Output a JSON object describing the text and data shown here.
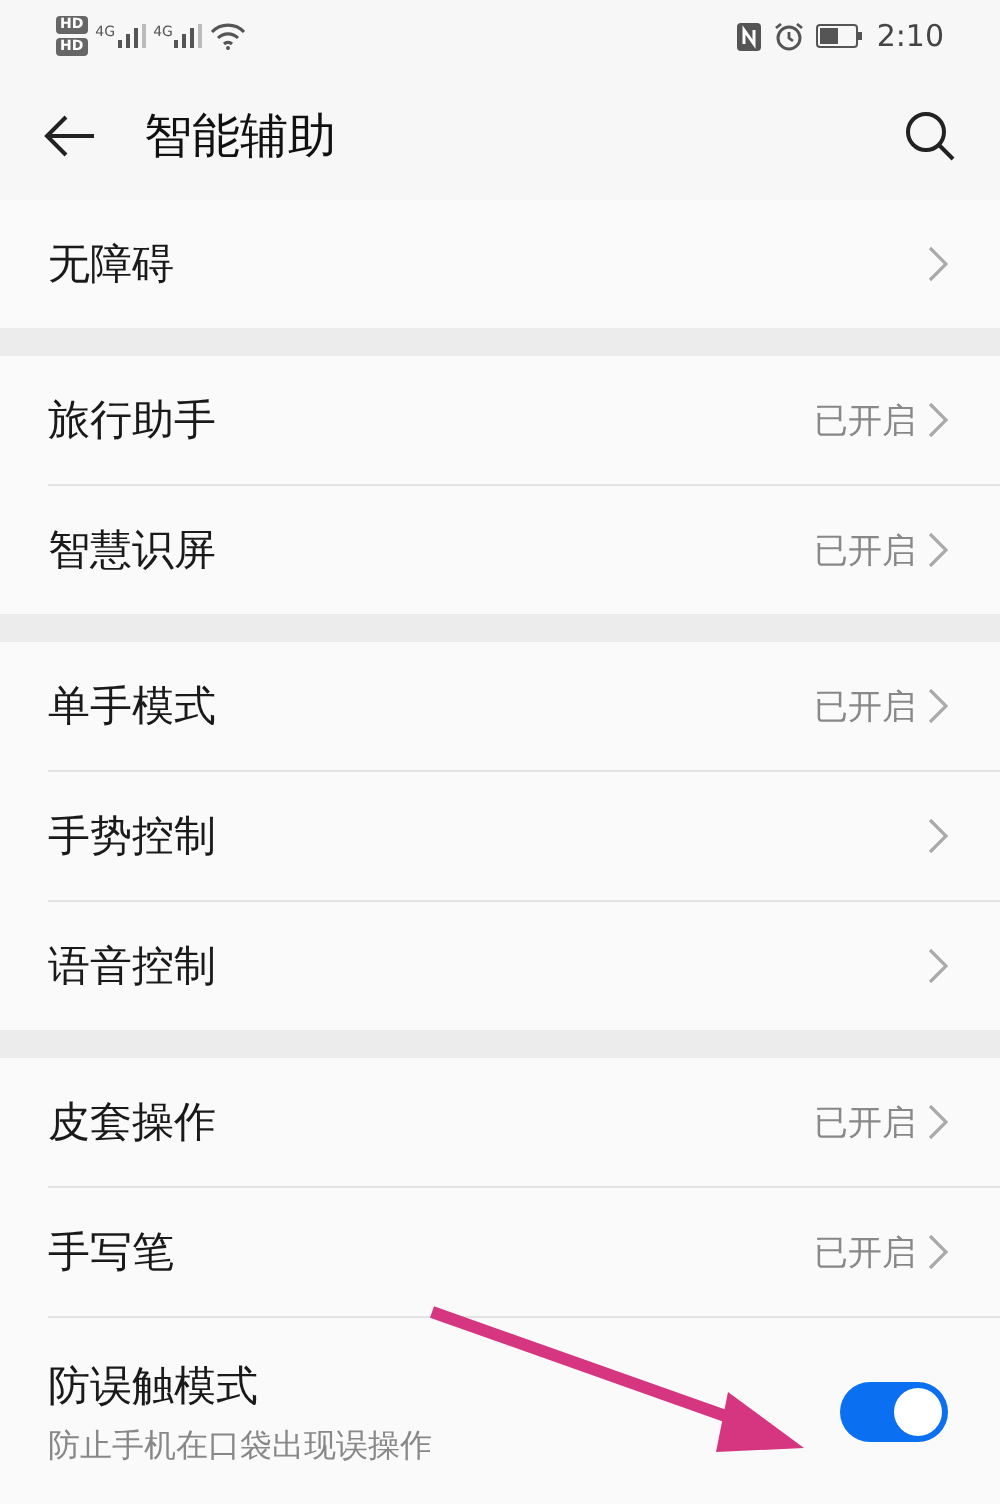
{
  "status_bar": {
    "hd_badges": [
      "HD",
      "HD"
    ],
    "network_labels": [
      "4G",
      "4G"
    ],
    "time": "2:10"
  },
  "header": {
    "title": "智能辅助"
  },
  "groups": [
    {
      "items": [
        {
          "kind": "link",
          "label": "无障碍"
        }
      ]
    },
    {
      "items": [
        {
          "kind": "link",
          "label": "旅行助手",
          "status": "已开启"
        },
        {
          "kind": "link",
          "label": "智慧识屏",
          "status": "已开启"
        }
      ]
    },
    {
      "items": [
        {
          "kind": "link",
          "label": "单手模式",
          "status": "已开启"
        },
        {
          "kind": "link",
          "label": "手势控制"
        },
        {
          "kind": "link",
          "label": "语音控制"
        }
      ]
    },
    {
      "items": [
        {
          "kind": "link",
          "label": "皮套操作",
          "status": "已开启"
        },
        {
          "kind": "link",
          "label": "手写笔",
          "status": "已开启"
        },
        {
          "kind": "toggle",
          "label": "防误触模式",
          "description": "防止手机在口袋出现误操作",
          "on": true
        }
      ]
    }
  ],
  "annotation": {
    "kind": "arrow"
  }
}
